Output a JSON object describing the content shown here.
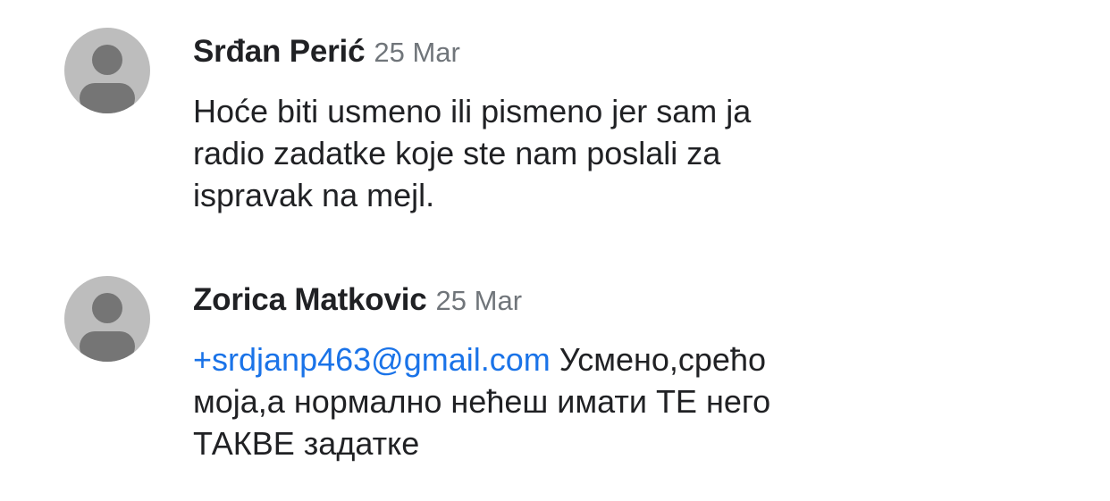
{
  "comments": [
    {
      "author": "Srđan Perić",
      "date": "25 Mar",
      "body_lines": [
        "Hoće biti usmeno ili pismeno jer sam ja",
        "radio zadatke koje ste nam poslali za",
        "ispravak na mejl."
      ]
    },
    {
      "author": "Zorica Matkovic",
      "date": "25 Mar",
      "mention_prefix": "+",
      "mention": "srdjanp463@gmail.com",
      "body_lines": [
        " Усмено,срећо",
        "моја,а нормално нећеш имати ТЕ него",
        "ТАКВЕ задатке"
      ]
    }
  ],
  "colors": {
    "avatar_bg": "#bdbdbd",
    "avatar_fg": "#757575",
    "mention": "#1a73e8",
    "date": "#70757a",
    "text": "#202124"
  },
  "icons": {
    "avatar": "person-placeholder-icon"
  }
}
